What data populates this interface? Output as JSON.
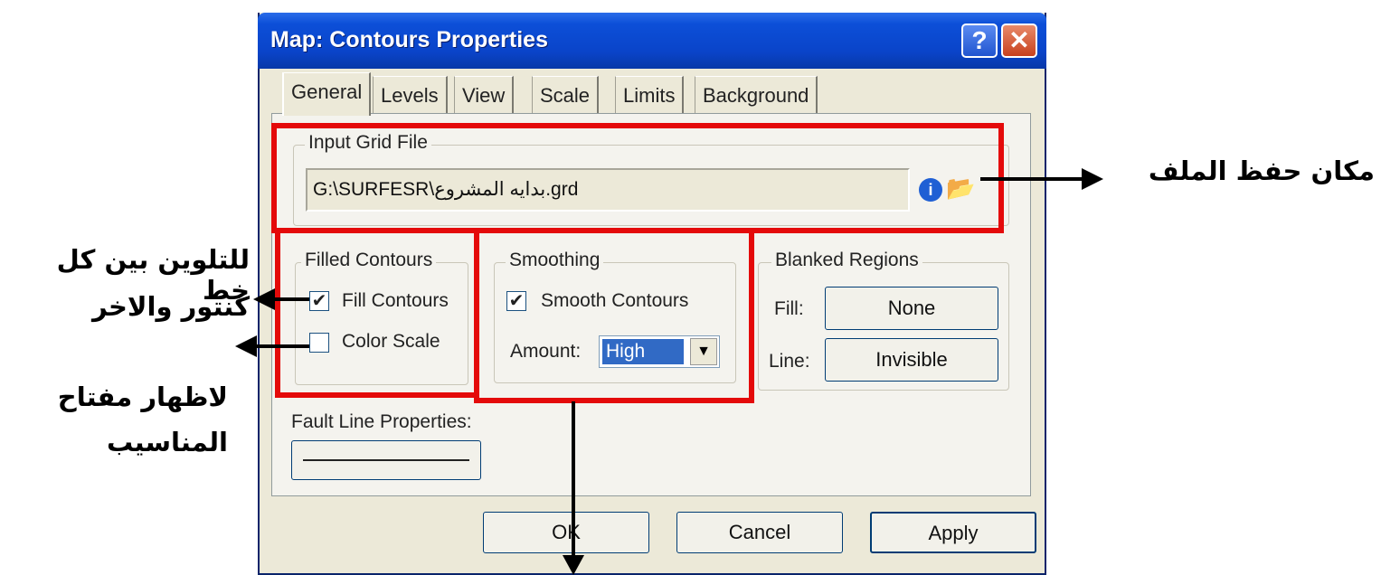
{
  "dialog": {
    "title": "Map: Contours Properties",
    "help_label": "?",
    "close_label": "✕"
  },
  "tabs": [
    {
      "label": "General"
    },
    {
      "label": "Levels"
    },
    {
      "label": "View"
    },
    {
      "label": "Scale"
    },
    {
      "label": "Limits"
    },
    {
      "label": "Background"
    }
  ],
  "input_grid": {
    "group_label": "Input Grid File",
    "path": "G:\\SURFESR\\بدايه المشروع.grd"
  },
  "filled_contours": {
    "group_label": "Filled Contours",
    "fill_label": "Fill Contours",
    "fill_checked": true,
    "color_scale_label": "Color Scale",
    "color_scale_checked": false
  },
  "smoothing": {
    "group_label": "Smoothing",
    "smooth_label": "Smooth Contours",
    "smooth_checked": true,
    "amount_label": "Amount:",
    "amount_value": "High"
  },
  "blanked": {
    "group_label": "Blanked Regions",
    "fill_label": "Fill:",
    "fill_value": "None",
    "line_label": "Line:",
    "line_value": "Invisible"
  },
  "fault": {
    "label": "Fault Line Properties:"
  },
  "buttons": {
    "ok": "OK",
    "cancel": "Cancel",
    "apply": "Apply"
  },
  "annotations": {
    "file_location": "مكان حفظ الملف",
    "fill_note_line1": "للتلوين بين كل خط",
    "fill_note_line2": "كنتور والاخر",
    "scale_note_line1": "لاظهار مفتاح",
    "scale_note_line2": "المناسيب"
  },
  "colors": {
    "highlight_red": "#e40a0a",
    "titlebar_blue": "#0a44c9",
    "selection_blue": "#316ac5"
  }
}
